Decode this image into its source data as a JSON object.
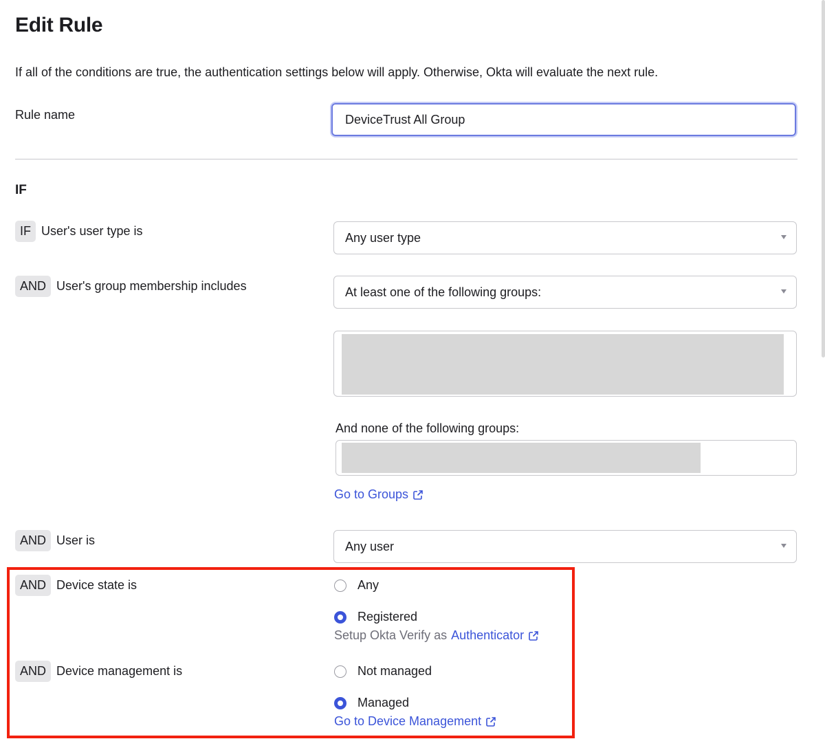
{
  "page": {
    "title": "Edit Rule",
    "intro": "If all of the conditions are true, the authentication settings below will apply. Otherwise, Okta will evaluate the next rule."
  },
  "rule_name": {
    "label": "Rule name",
    "value": "DeviceTrust All Group"
  },
  "if_heading": "IF",
  "conditions": {
    "user_type": {
      "badge": "IF",
      "label": "User's user type is",
      "selected": "Any user type"
    },
    "group_membership": {
      "badge": "AND",
      "label": "User's group membership includes",
      "selected": "At least one of the following groups:",
      "none_label": "And none of the following groups:",
      "groups_link": "Go to Groups"
    },
    "user_is": {
      "badge": "AND",
      "label": "User is",
      "selected": "Any user"
    },
    "device_state": {
      "badge": "AND",
      "label": "Device state is",
      "options": [
        "Any",
        "Registered"
      ],
      "selected": "Registered",
      "helper_text": "Setup Okta Verify as",
      "helper_link": "Authenticator"
    },
    "device_management": {
      "badge": "AND",
      "label": "Device management is",
      "options": [
        "Not managed",
        "Managed"
      ],
      "selected": "Managed",
      "link": "Go to Device Management"
    }
  },
  "colors": {
    "accent": "#3b54d9",
    "highlight": "#f2210f",
    "focus": "#6b7ae0"
  },
  "icons": {
    "external_link": "external-link-icon",
    "dropdown": "caret-down-icon"
  }
}
